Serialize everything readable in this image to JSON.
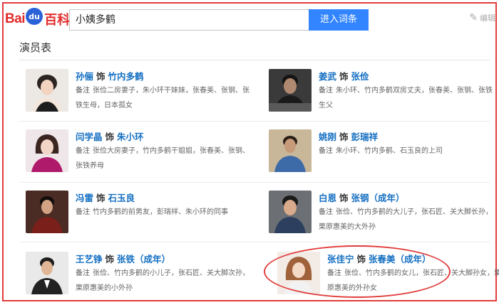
{
  "header": {
    "logo_part1": "Bai",
    "logo_part2": "du",
    "logo_part3": "百科",
    "search_value": "小姨多鹤",
    "search_button": "进入词条",
    "edit_label": "编辑"
  },
  "section_title": "演员表",
  "cast": [
    {
      "actor": "孙俪",
      "shi": "饰",
      "role": "竹内多鹤",
      "note_label": "备注",
      "note": "张俭二房妻子，朱小环干妹妹，张春美、张钢、张铁生母，日本孤女"
    },
    {
      "actor": "姜武",
      "shi": "饰",
      "role": "张俭",
      "note_label": "备注",
      "note": "朱小环、竹内多鹤双房丈夫，张春美、张钢、张铁生父"
    },
    {
      "actor": "闫学晶",
      "shi": "饰",
      "role": "朱小环",
      "note_label": "备注",
      "note": "张俭大房妻子，竹内多鹤干姐姐，张春美、张钢、张铁养母"
    },
    {
      "actor": "姚刚",
      "shi": "饰",
      "role": "彭瑞祥",
      "note_label": "备注",
      "note": "朱小环、竹内多鹤、石玉良的上司"
    },
    {
      "actor": "冯雷",
      "shi": "饰",
      "role": "石玉良",
      "note_label": "备注",
      "note": "竹内多鹤的前男友，彭瑞祥、朱小环的同事"
    },
    {
      "actor": "白恩",
      "shi": "饰",
      "role": "张钢（成年）",
      "note_label": "备注",
      "note": "张俭、竹内多鹤的大儿子，张石匠、关大脚长孙，栗原惠美的大外孙"
    },
    {
      "actor": "王艺铮",
      "shi": "饰",
      "role": "张铁（成年）",
      "note_label": "备注",
      "note": "张俭、竹内多鹤的小儿子，张石匠、关大脚次孙，栗原惠美的小外孙"
    },
    {
      "actor": "张佳宁",
      "shi": "饰",
      "role": "张春美（成年）",
      "note_label": "备注",
      "note": "张俭、竹内多鹤的女儿，张石匠、关大脚孙女，栗原惠美的外孙女"
    }
  ]
}
